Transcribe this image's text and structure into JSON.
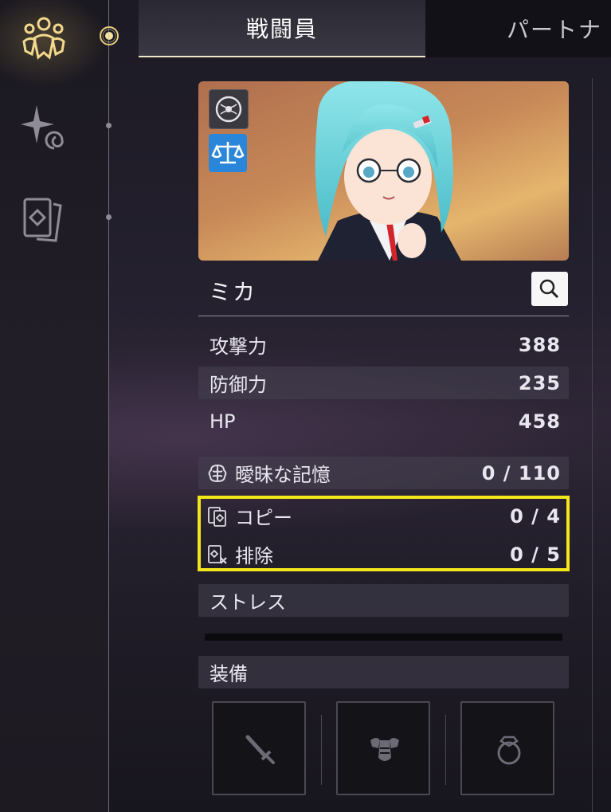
{
  "tabs": {
    "active": "戦闘員",
    "inactive": "パートナ"
  },
  "sidebar": {
    "items": [
      {
        "icon": "character-icon",
        "active": true
      },
      {
        "icon": "sparkle-spiral-icon",
        "active": false
      },
      {
        "icon": "card-deck-icon",
        "active": false
      }
    ]
  },
  "character": {
    "name": "ミカ",
    "badges": [
      "mind-orb-icon",
      "balance-scale-icon"
    ]
  },
  "stats": [
    {
      "label": "攻撃力",
      "value": "388"
    },
    {
      "label": "防御力",
      "value": "235"
    },
    {
      "label": "HP",
      "value": "458"
    }
  ],
  "memory": {
    "label": "曖昧な記憶",
    "value": "0 / 110"
  },
  "deck": {
    "copy": {
      "label": "コピー",
      "value": "0 / 4"
    },
    "remove": {
      "label": "排除",
      "value": "0 / 5"
    }
  },
  "stress": {
    "label": "ストレス",
    "progress": 0
  },
  "equipment": {
    "label": "装備",
    "slots": [
      "sword-icon",
      "armor-icon",
      "ring-icon"
    ]
  },
  "colors": {
    "highlight": "#f3e61a",
    "accent": "#f0d98a",
    "badge_blue": "#2a86d8"
  }
}
